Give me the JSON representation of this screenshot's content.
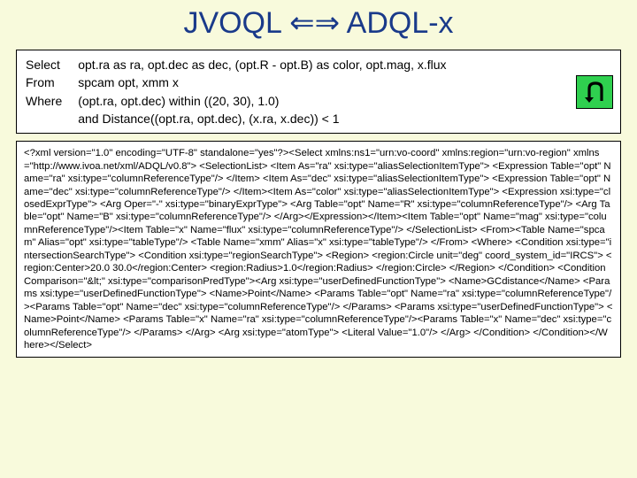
{
  "title": "JVOQL ⇐⇒ ADQL-x",
  "sql": {
    "keywords": [
      "Select",
      "From",
      "Where"
    ],
    "lines": [
      "opt.ra as ra, opt.dec as dec, (opt.R - opt.B) as color, opt.mag, x.flux",
      "spcam opt, xmm x",
      "(opt.ra, opt.dec) within ((20, 30), 1.0)",
      "and Distance((opt.ra, opt.dec), (x.ra, x.dec)) < 1"
    ]
  },
  "icon": "u-turn-icon",
  "xml": "<?xml version=\"1.0\" encoding=\"UTF-8\" standalone=\"yes\"?><Select xmlns:ns1=\"urn:vo-coord\" xmlns:region=\"urn:vo-region\" xmlns=\"http://www.ivoa.net/xml/ADQL/v0.8\"> <SelectionList> <Item As=\"ra\" xsi:type=\"aliasSelectionItemType\"> <Expression Table=\"opt\" Name=\"ra\" xsi:type=\"columnReferenceType\"/> </Item> <Item As=\"dec\" xsi:type=\"aliasSelectionItemType\"> <Expression Table=\"opt\" Name=\"dec\" xsi:type=\"columnReferenceType\"/> </Item><Item As=\"color\" xsi:type=\"aliasSelectionItemType\"> <Expression xsi:type=\"closedExprType\"> <Arg Oper=\"-\" xsi:type=\"binaryExprType\"> <Arg Table=\"opt\" Name=\"R\" xsi:type=\"columnReferenceType\"/> <Arg Table=\"opt\" Name=\"B\" xsi:type=\"columnReferenceType\"/> </Arg></Expression></Item><Item Table=\"opt\" Name=\"mag\" xsi:type=\"columnReferenceType\"/><Item Table=\"x\" Name=\"flux\" xsi:type=\"columnReferenceType\"/> </SelectionList> <From><Table Name=\"spcam\" Alias=\"opt\" xsi:type=\"tableType\"/> <Table Name=\"xmm\" Alias=\"x\" xsi:type=\"tableType\"/> </From> <Where> <Condition xsi:type=\"intersectionSearchType\"> <Condition xsi:type=\"regionSearchType\"> <Region> <region:Circle unit=\"deg\" coord_system_id=\"IRCS\"> <region:Center>20.0 30.0</region:Center> <region:Radius>1.0</region:Radius> </region:Circle> </Region> </Condition> <Condition Comparison=\"&lt;\" xsi:type=\"comparisonPredType\"><Arg xsi:type=\"userDefinedFunctionType\"> <Name>GCdistance</Name> <Params xsi:type=\"userDefinedFunctionType\"> <Name>Point</Name> <Params Table=\"opt\" Name=\"ra\" xsi:type=\"columnReferenceType\"/><Params Table=\"opt\" Name=\"dec\" xsi:type=\"columnReferenceType\"/> </Params> <Params xsi:type=\"userDefinedFunctionType\"> <Name>Point</Name> <Params Table=\"x\" Name=\"ra\" xsi:type=\"columnReferenceType\"/><Params Table=\"x\" Name=\"dec\" xsi:type=\"columnReferenceType\"/> </Params> </Arg> <Arg xsi:type=\"atomType\"> <Literal Value=\"1.0\"/> </Arg> </Condition> </Condition></Where></Select>"
}
